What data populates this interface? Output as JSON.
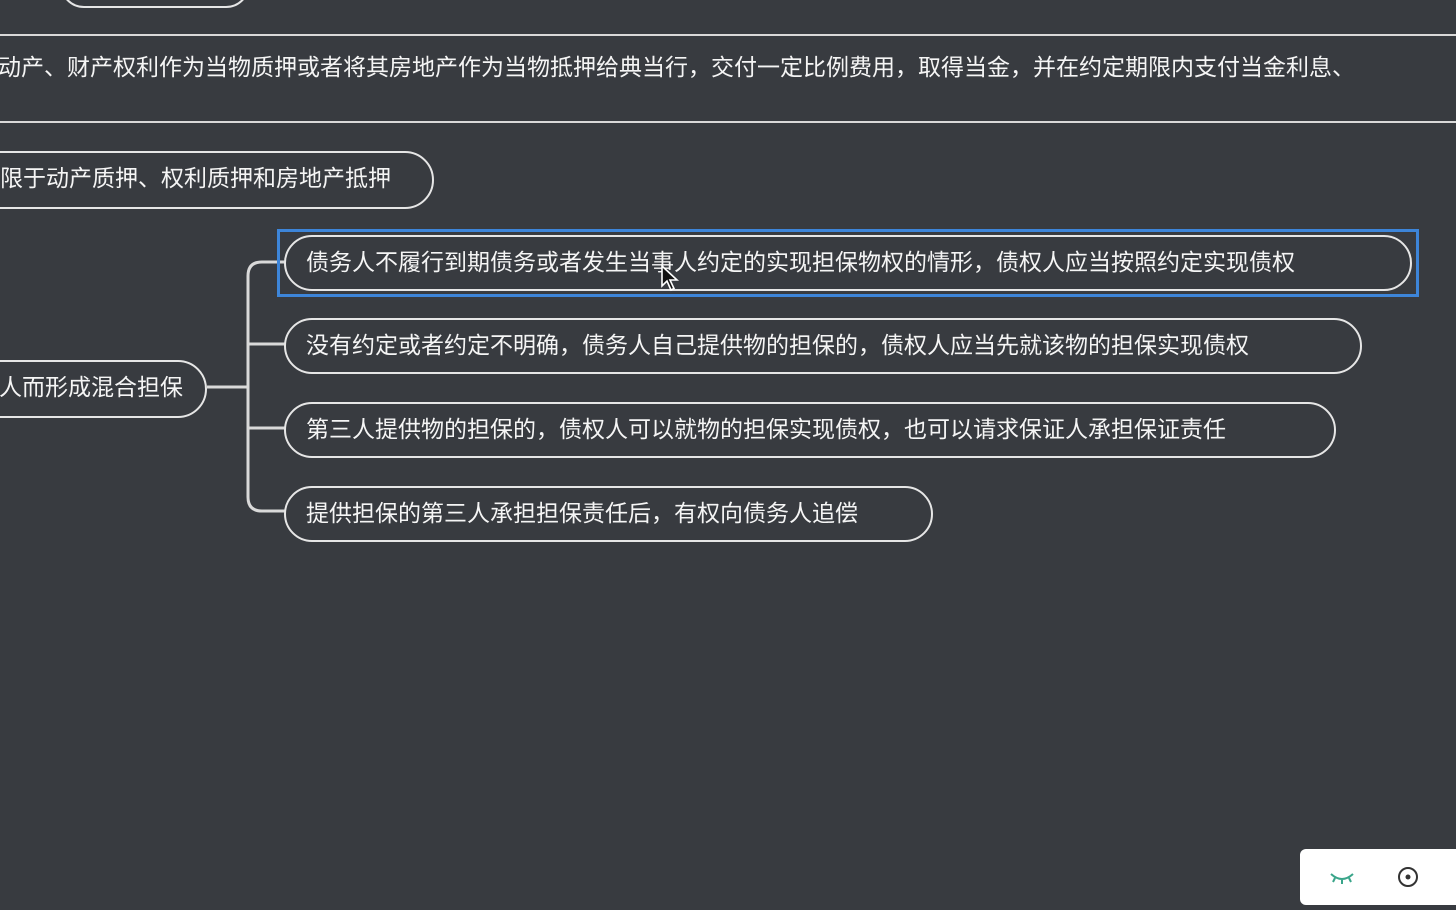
{
  "top_paragraph": {
    "line1": "动产、财产权利作为当物质押或者将其房地产作为当物抵押给典当行，交付一定比例费用，取得当金，并在约定期限内支付当金利息、"
  },
  "nodes": {
    "limit_node": "限于动产质押、权利质押和房地产抵押",
    "parent_node": "人而形成混合担保",
    "children": [
      "债务人不履行到期债务或者发生当事人约定的实现担保物权的情形，债权人应当按照约定实现债权",
      "没有约定或者约定不明确，债务人自己提供物的担保的，债权人应当先就该物的担保实现债权",
      "第三人提供物的担保的，债权人可以就物的担保实现债权，也可以请求保证人承担保证责任",
      "提供担保的第三人承担担保责任后，有权向债务人追偿"
    ]
  },
  "toolbar": {
    "icons": [
      "eye-closed-icon",
      "target-icon"
    ],
    "accent": "#3aa58a"
  },
  "colors": {
    "background": "#383b40",
    "selection": "#3d85d9",
    "node_border": "#e6e6e6"
  }
}
